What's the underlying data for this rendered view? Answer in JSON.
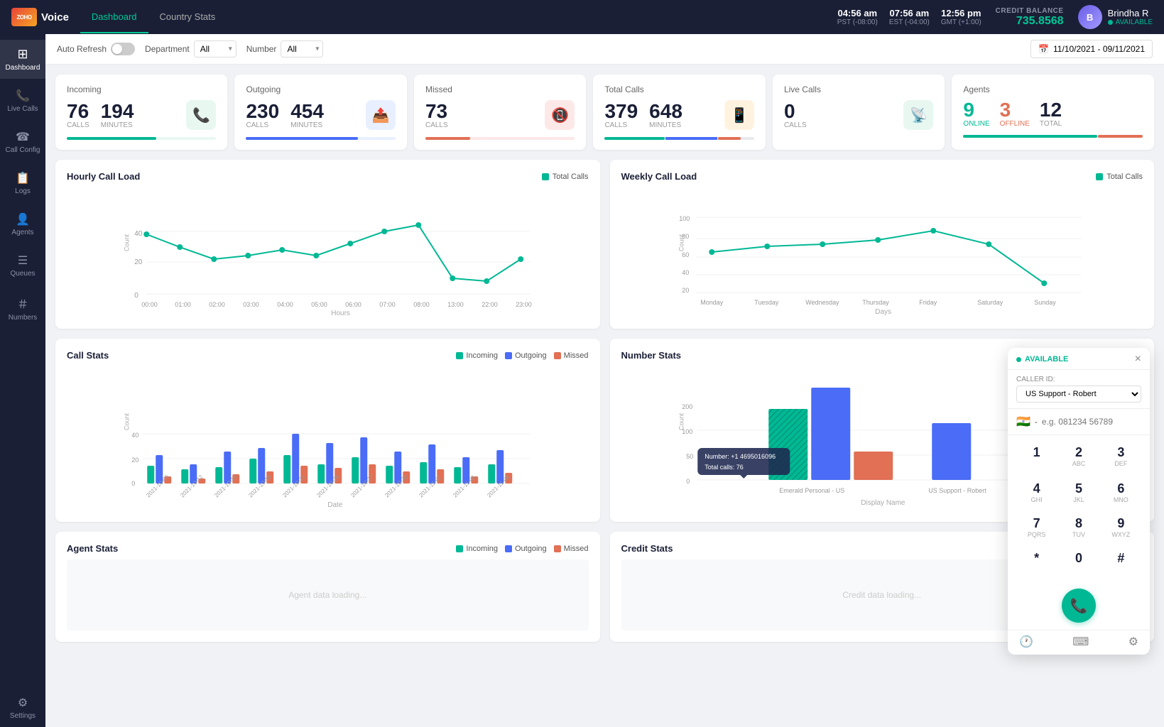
{
  "app": {
    "logo_text": "ZOHO",
    "app_name": "Voice"
  },
  "times": [
    {
      "value": "04:56 am",
      "zone": "PST (-08:00)"
    },
    {
      "value": "07:56 am",
      "zone": "EST (-04:00)"
    },
    {
      "value": "12:56 pm",
      "zone": "GMT (+1:00)"
    }
  ],
  "credit": {
    "label": "CREDIT BALANCE",
    "value": "735.8568"
  },
  "user": {
    "name": "Brindha R",
    "status": "AVAILABLE",
    "avatar_letter": "B"
  },
  "header": {
    "tabs": [
      "Dashboard",
      "Country Stats"
    ],
    "active_tab": "Dashboard",
    "auto_refresh_label": "Auto Refresh",
    "department_label": "Department",
    "department_value": "All",
    "number_label": "Number",
    "number_value": "All",
    "date_range": "11/10/2021 - 09/11/2021"
  },
  "sidebar": {
    "items": [
      {
        "id": "dashboard",
        "icon": "⊞",
        "label": "Dashboard"
      },
      {
        "id": "live-calls",
        "icon": "📞",
        "label": "Live Calls"
      },
      {
        "id": "call-config",
        "icon": "☎",
        "label": "Call Config"
      },
      {
        "id": "logs",
        "icon": "📋",
        "label": "Logs"
      },
      {
        "id": "agents",
        "icon": "👤",
        "label": "Agents"
      },
      {
        "id": "queues",
        "icon": "☰",
        "label": "Queues"
      },
      {
        "id": "numbers",
        "icon": "#",
        "label": "Numbers"
      },
      {
        "id": "settings",
        "icon": "⚙",
        "label": "Settings"
      }
    ]
  },
  "stat_cards": {
    "incoming": {
      "title": "Incoming",
      "calls": "76",
      "calls_label": "CALLS",
      "minutes": "194",
      "minutes_label": "MINUTES",
      "icon": "📞",
      "icon_bg": "#e8f8f1",
      "icon_color": "#00b894",
      "bar_color": "#00b894",
      "bar_width": "60%"
    },
    "outgoing": {
      "title": "Outgoing",
      "calls": "230",
      "calls_label": "CALLS",
      "minutes": "454",
      "minutes_label": "MINUTES",
      "icon": "📤",
      "icon_bg": "#e8f0ff",
      "icon_color": "#4a6cf7",
      "bar_color": "#4a6cf7",
      "bar_width": "75%"
    },
    "missed": {
      "title": "Missed",
      "calls": "73",
      "calls_label": "CALLS",
      "icon": "📵",
      "icon_bg": "#fde8e8",
      "icon_color": "#e17055",
      "bar_color": "#e17055",
      "bar_width": "30%"
    },
    "total": {
      "title": "Total Calls",
      "calls": "379",
      "calls_label": "CALLS",
      "minutes": "648",
      "minutes_label": "MINUTES",
      "icon": "📱",
      "icon_bg": "#fff3e0",
      "icon_color": "#f39c12",
      "bar_color_green": "#00b894",
      "bar_color_blue": "#4a6cf7",
      "bar_color_red": "#e17055"
    },
    "live_calls": {
      "title": "Live Calls",
      "calls": "0",
      "calls_label": "CALLS",
      "icon": "📡",
      "icon_bg": "#e8f8f1",
      "icon_color": "#00b894"
    },
    "agents": {
      "title": "Agents",
      "online": "9",
      "online_label": "ONLINE",
      "offline": "3",
      "offline_label": "OFFLINE",
      "total": "12",
      "total_label": "TOTAL"
    }
  },
  "hourly_chart": {
    "title": "Hourly Call Load",
    "legend_label": "Total Calls",
    "x_labels": [
      "00:00",
      "01:00",
      "02:00",
      "03:00",
      "04:00",
      "05:00",
      "06:00",
      "07:00",
      "08:00",
      "13:00",
      "22:00",
      "23:00"
    ],
    "x_label_axis": "Hours",
    "y_labels": [
      "0",
      "20",
      "40"
    ],
    "data_points": [
      38,
      28,
      22,
      25,
      28,
      25,
      32,
      35,
      46,
      10,
      8,
      22
    ]
  },
  "weekly_chart": {
    "title": "Weekly Call Load",
    "legend_label": "Total Calls",
    "x_labels": [
      "Monday",
      "Tuesday",
      "Wednesday",
      "Thursday",
      "Friday",
      "Saturday",
      "Sunday"
    ],
    "x_label_axis": "Days",
    "y_labels": [
      "20",
      "40",
      "60",
      "80",
      "100"
    ],
    "data_points": [
      63,
      68,
      70,
      75,
      86,
      70,
      30
    ]
  },
  "call_stats_chart": {
    "title": "Call Stats",
    "legend": [
      "Incoming",
      "Outgoing",
      "Missed"
    ],
    "x_label": "Date",
    "dates": [
      "2021-10-09",
      "2021-10-12",
      "2021-10-15",
      "2021-10-18",
      "2021-10-21",
      "2021-10-24",
      "2021-10-27",
      "2021-10-30",
      "2021-11-02",
      "2021-11-05",
      "2021-11-08"
    ]
  },
  "number_stats_chart": {
    "title": "Number Stats",
    "x_label": "Display Name",
    "labels": [
      "Emerald Personal - US",
      "US Support - Robert"
    ],
    "tooltip": {
      "number": "+1 4695016096",
      "total_calls": "76"
    }
  },
  "agent_stats": {
    "title": "Agent Stats",
    "legend": [
      "Incoming",
      "Outgoing",
      "Missed"
    ]
  },
  "credit_stats": {
    "title": "Credit Stats"
  },
  "dialpad": {
    "available_label": "AVAILABLE",
    "close_label": "×",
    "caller_id_label": "CALLER ID:",
    "caller_id_value": "US Support - Robert",
    "phone_placeholder": "e.g. 081234 56789",
    "keys": [
      {
        "num": "1",
        "alpha": ""
      },
      {
        "num": "2",
        "alpha": "ABC"
      },
      {
        "num": "3",
        "alpha": "DEF"
      },
      {
        "num": "4",
        "alpha": "GHI"
      },
      {
        "num": "5",
        "alpha": "JKL"
      },
      {
        "num": "6",
        "alpha": "MNO"
      },
      {
        "num": "7",
        "alpha": "PQRS"
      },
      {
        "num": "8",
        "alpha": "TUV"
      },
      {
        "num": "9",
        "alpha": "WXYZ"
      },
      {
        "num": "*",
        "alpha": ""
      },
      {
        "num": "0",
        "alpha": ""
      },
      {
        "num": "#",
        "alpha": ""
      }
    ]
  }
}
